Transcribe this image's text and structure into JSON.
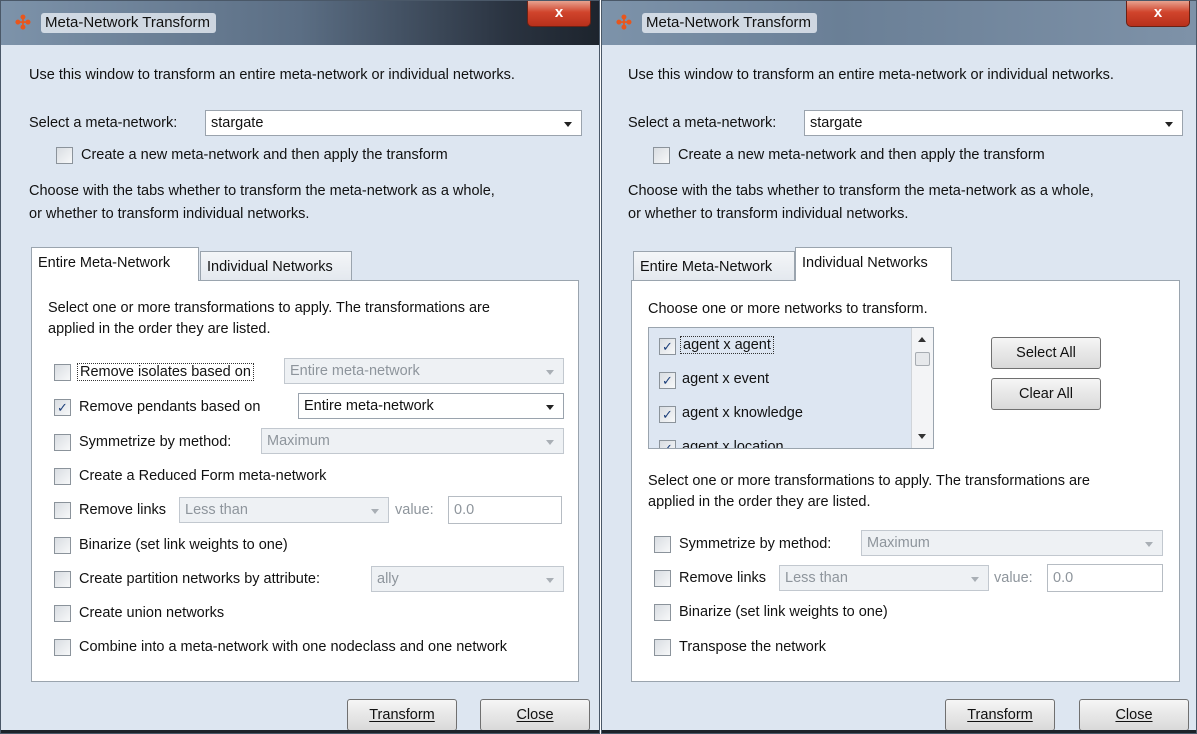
{
  "left_window": {
    "title": "Meta-Network Transform",
    "close_label": "x",
    "intro": "Use this window to transform an entire meta-network or individual networks.",
    "select_label": "Select a meta-network:",
    "select_value": "stargate",
    "create_new_label": "Create a new meta-network and then apply the transform",
    "choose_line1": "Choose with the tabs whether to transform the meta-network as a whole,",
    "choose_line2": "or whether to transform individual networks.",
    "tabs": [
      {
        "label": "Entire Meta-Network",
        "active": true
      },
      {
        "label": "Individual Networks",
        "active": false
      }
    ],
    "panel_line1": "Select one or more transformations to apply. The transformations are",
    "panel_line2": "applied in the order they are listed.",
    "options": {
      "remove_isolates": {
        "label": "Remove isolates based on",
        "checked": false,
        "combo": "Entire meta-network"
      },
      "remove_pendants": {
        "label": "Remove pendants based on",
        "checked": true,
        "combo": "Entire meta-network"
      },
      "symmetrize": {
        "label": "Symmetrize by method:",
        "checked": false,
        "combo": "Maximum"
      },
      "reduced_form": {
        "label": "Create a Reduced Form meta-network",
        "checked": false
      },
      "remove_links": {
        "label": "Remove links",
        "checked": false,
        "combo": "Less than",
        "value_label": "value:",
        "value": "0.0"
      },
      "binarize": {
        "label": "Binarize (set link weights to one)",
        "checked": false
      },
      "partition": {
        "label": "Create partition networks by attribute:",
        "checked": false,
        "combo": "ally"
      },
      "union": {
        "label": "Create union networks",
        "checked": false
      },
      "combine": {
        "label": "Combine into a meta-network with one nodeclass and one network",
        "checked": false
      }
    },
    "transform_label": "Transform",
    "close_btn_label": "Close"
  },
  "right_window": {
    "title": "Meta-Network Transform",
    "close_label": "x",
    "intro": "Use this window to transform an entire meta-network or individual networks.",
    "select_label": "Select a meta-network:",
    "select_value": "stargate",
    "create_new_label": "Create a new meta-network and then apply the transform",
    "choose_line1": "Choose with the tabs whether to transform the meta-network as a whole,",
    "choose_line2": "or whether to transform individual networks.",
    "tabs": [
      {
        "label": "Entire Meta-Network",
        "active": false
      },
      {
        "label": "Individual Networks",
        "active": true
      }
    ],
    "networks_prompt": "Choose one or more networks to transform.",
    "networks": [
      {
        "label": "agent x agent",
        "checked": true
      },
      {
        "label": "agent x event",
        "checked": true
      },
      {
        "label": "agent x knowledge",
        "checked": true
      },
      {
        "label": "agent x location",
        "checked": true
      }
    ],
    "select_all_label": "Select All",
    "clear_all_label": "Clear All",
    "panel_line1": "Select one or more transformations to apply. The transformations are",
    "panel_line2": "applied in the order they are listed.",
    "options": {
      "symmetrize": {
        "label": "Symmetrize by method:",
        "checked": false,
        "combo": "Maximum"
      },
      "remove_links": {
        "label": "Remove links",
        "checked": false,
        "combo": "Less than",
        "value_label": "value:",
        "value": "0.0"
      },
      "binarize": {
        "label": "Binarize (set link weights to one)",
        "checked": false
      },
      "transpose": {
        "label": "Transpose the network",
        "checked": false
      }
    },
    "transform_label": "Transform",
    "close_btn_label": "Close"
  },
  "colors": {
    "window_bg": "#dde6f1",
    "panel_bg": "#ffffff",
    "close_button": "#c9412b",
    "app_icon": "#e8561c"
  },
  "icons": {
    "app": "app-logo-icon",
    "close": "close-icon",
    "dropdown": "chevron-down-icon",
    "check": "checkmark-icon"
  }
}
